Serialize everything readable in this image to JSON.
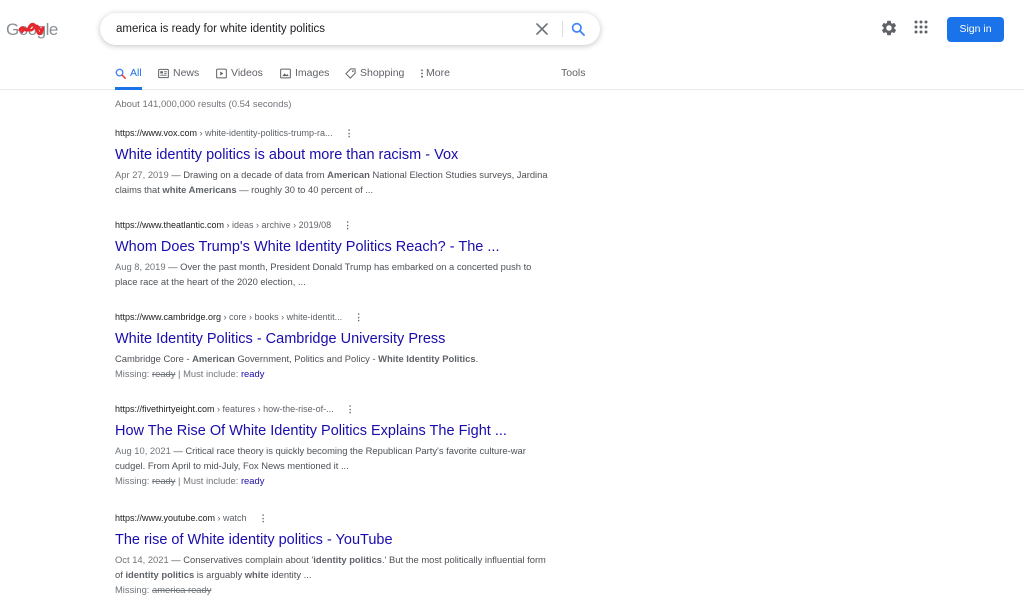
{
  "header": {
    "logo_text": "Google",
    "search_value": "america is ready for white identity politics",
    "signin_label": "Sign in"
  },
  "tabs": [
    {
      "label": "All",
      "icon": "search-icon",
      "active": true
    },
    {
      "label": "News",
      "icon": "news-icon"
    },
    {
      "label": "Videos",
      "icon": "video-icon"
    },
    {
      "label": "Images",
      "icon": "image-icon"
    },
    {
      "label": "Shopping",
      "icon": "tag-icon"
    },
    {
      "label": "More",
      "icon": "more-vert-icon"
    },
    {
      "label": "Tools"
    }
  ],
  "stats": "About 141,000,000 results (0.54 seconds)",
  "results": [
    {
      "site": "https://www.vox.com",
      "path": " › white-identity-politics-trump-ra...",
      "title": "White identity politics is about more than racism - Vox",
      "date": "Apr 27, 2019",
      "snippet_parts": [
        {
          "t": " — Drawing on a decade of data from "
        },
        {
          "b": "American"
        },
        {
          "t": " National Election Studies surveys, Jardina claims that "
        },
        {
          "b": "white Americans"
        },
        {
          "t": " — roughly 30 to 40 percent of ..."
        }
      ]
    },
    {
      "site": "https://www.theatlantic.com",
      "path": " › ideas › archive › 2019/08",
      "title": "Whom Does Trump's White Identity Politics Reach? - The ...",
      "date": "Aug 8, 2019",
      "snippet_parts": [
        {
          "t": " — Over the past month, President Donald Trump has embarked on a concerted push to place race at the heart of the 2020 election, ..."
        }
      ]
    },
    {
      "site": "https://www.cambridge.org",
      "path": " › core › books › white-identit...",
      "title": "White Identity Politics - Cambridge University Press",
      "snippet_parts": [
        {
          "t": "Cambridge Core - "
        },
        {
          "b": "American"
        },
        {
          "t": " Government, Politics and Policy - "
        },
        {
          "b": "White Identity Politics"
        },
        {
          "t": "."
        }
      ],
      "missing": {
        "prefix": "Missing: ",
        "struck": "ready",
        "sep": " | Must include: ",
        "link": "ready"
      }
    },
    {
      "site": "https://fivethirtyeight.com",
      "path": " › features › how-the-rise-of-...",
      "title": "How The Rise Of White Identity Politics Explains The Fight ...",
      "date": "Aug 10, 2021",
      "snippet_parts": [
        {
          "t": " — Critical race theory is quickly becoming the Republican Party's favorite culture-war cudgel. From April to mid-July, Fox News mentioned it ..."
        }
      ],
      "missing": {
        "prefix": "Missing: ",
        "struck": "ready",
        "sep": " | Must include: ",
        "link": "ready"
      }
    },
    {
      "site": "https://www.youtube.com",
      "path": " › watch",
      "title": "The rise of White identity politics - YouTube",
      "date": "Oct 14, 2021",
      "snippet_parts": [
        {
          "t": " — Conservatives complain about '"
        },
        {
          "b": "identity politics"
        },
        {
          "t": ".' But the most politically influential form of "
        },
        {
          "b": "identity politics"
        },
        {
          "t": " is arguably "
        },
        {
          "b": "white"
        },
        {
          "t": " identity ..."
        }
      ],
      "missing": {
        "prefix": "Missing: ",
        "struck": "america ready"
      }
    }
  ]
}
